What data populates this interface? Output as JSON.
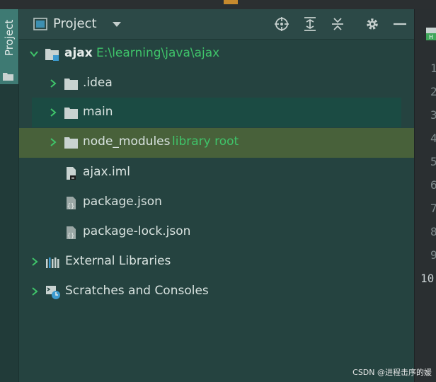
{
  "panel": {
    "tab_label": "Project",
    "title": "Project"
  },
  "tree": {
    "root": {
      "name": "ajax",
      "path": "E:\\learning\\java\\ajax"
    },
    "items": [
      {
        "label": ".idea"
      },
      {
        "label": "main"
      },
      {
        "label": "node_modules",
        "hint": "library root"
      },
      {
        "label": "ajax.iml"
      },
      {
        "label": "package.json"
      },
      {
        "label": "package-lock.json"
      }
    ],
    "external": "External Libraries",
    "scratches": "Scratches and Consoles"
  },
  "gutter": {
    "lines": [
      "1",
      "2",
      "3",
      "4",
      "5",
      "6",
      "7",
      "8",
      "9",
      "10"
    ]
  },
  "watermark": "CSDN @进程击序的媛",
  "colors": {
    "background": "#254340",
    "selected_row": "#1b4b43",
    "library_row": "#48613a",
    "hint_green": "#3fc46a",
    "tab_active": "#3e7a73"
  },
  "icons": [
    "project-icon",
    "dropdown-icon",
    "locate-icon",
    "expand-all-icon",
    "collapse-all-icon",
    "gear-icon",
    "hide-icon",
    "folder-icon",
    "file-icon",
    "json-file-icon",
    "library-icon",
    "scratch-icon"
  ]
}
